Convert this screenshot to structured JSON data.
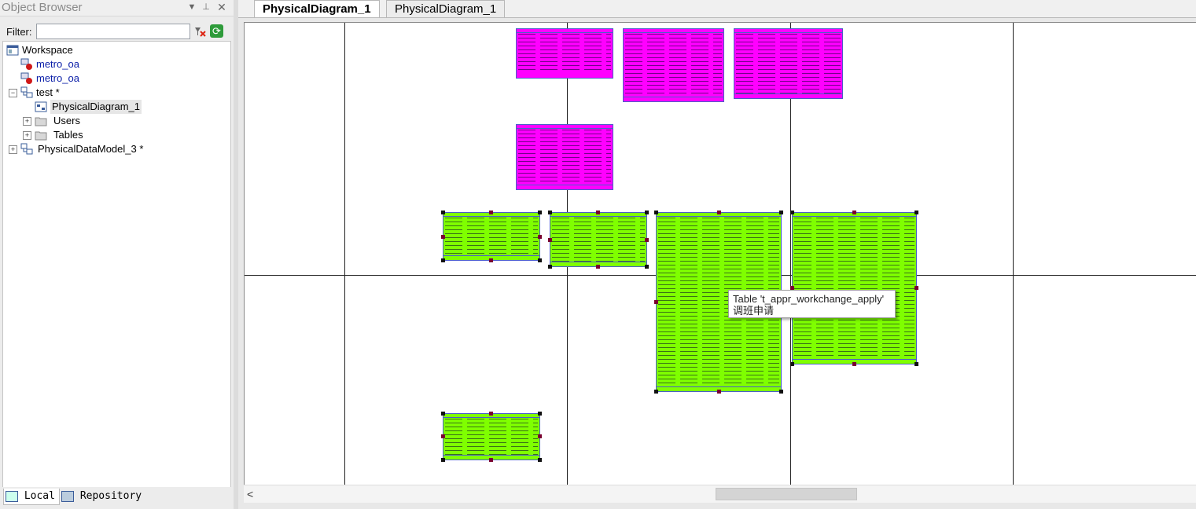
{
  "object_browser": {
    "title": "Object Browser",
    "filter_label": "Filter:",
    "filter_value": "",
    "tree": [
      {
        "label": "Workspace",
        "icon": "workspace-icon",
        "level": 0
      },
      {
        "label": "metro_oa",
        "icon": "database-connection-icon",
        "level": 1
      },
      {
        "label": "metro_oa",
        "icon": "database-connection-icon",
        "level": 1
      },
      {
        "label": "test *",
        "icon": "physical-model-icon",
        "level": 1
      },
      {
        "label": "PhysicalDiagram_1",
        "icon": "diagram-icon",
        "level": 2
      },
      {
        "label": "Users",
        "icon": "folder-icon",
        "level": 2
      },
      {
        "label": "Tables",
        "icon": "folder-icon",
        "level": 2
      },
      {
        "label": "PhysicalDataModel_3 *",
        "icon": "physical-model-icon",
        "level": 0
      }
    ],
    "bottom_tabs": [
      "Local",
      "Repository"
    ]
  },
  "diagram": {
    "tabs": [
      "PhysicalDiagram_1",
      "PhysicalDiagram_1"
    ],
    "active_tab": 0,
    "tooltip_line1": "Table 't_appr_workchange_apply'",
    "tooltip_line2": "调班申请",
    "colors": {
      "magenta_table": "#ff00ff",
      "green_table": "#7fff00",
      "table_border": "#4a60c8"
    }
  }
}
